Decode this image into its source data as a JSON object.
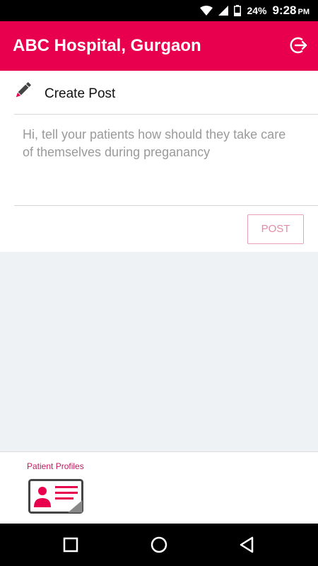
{
  "status_bar": {
    "battery": "24%",
    "time": "9:28",
    "ampm": "PM"
  },
  "app_bar": {
    "title": "ABC Hospital, Gurgaon"
  },
  "post_card": {
    "create_label": "Create Post",
    "placeholder": "Hi, tell your patients how should they take care of themselves during preganancy",
    "post_label": "POST"
  },
  "bottom_panel": {
    "patient_profiles_label": "Patient Profiles"
  },
  "colors": {
    "primary": "#e8004e",
    "accent_text": "#c2185b"
  }
}
